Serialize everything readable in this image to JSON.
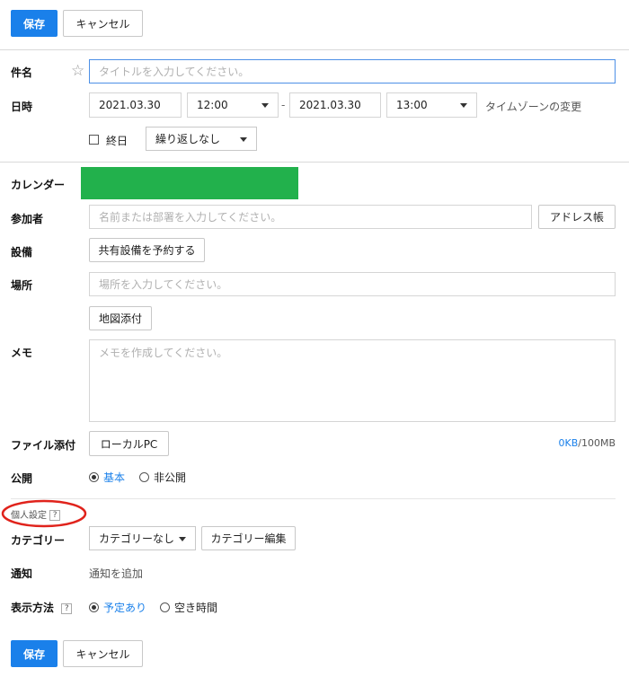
{
  "toolbar": {
    "save_label": "保存",
    "cancel_label": "キャンセル"
  },
  "subject": {
    "label": "件名",
    "placeholder": "タイトルを入力してください。"
  },
  "datetime": {
    "label": "日時",
    "start_date": "2021.03.30",
    "start_time": "12:00",
    "separator": "-",
    "end_date": "2021.03.30",
    "end_time": "13:00",
    "timezone_link": "タイムゾーンの変更",
    "all_day_label": "終日",
    "repeat_value": "繰り返しなし"
  },
  "calendar": {
    "label": "カレンダー",
    "color": "#22b14c"
  },
  "attendees": {
    "label": "参加者",
    "placeholder": "名前または部署を入力してください。",
    "address_book_label": "アドレス帳"
  },
  "equipment": {
    "label": "設備",
    "button_label": "共有設備を予約する"
  },
  "location": {
    "label": "場所",
    "placeholder": "場所を入力してください。",
    "map_button_label": "地図添付"
  },
  "memo": {
    "label": "メモ",
    "placeholder": "メモを作成してください。"
  },
  "attachment": {
    "label": "ファイル添付",
    "button_label": "ローカルPC",
    "used": "0KB",
    "limit": "/100MB"
  },
  "visibility": {
    "label": "公開",
    "options": [
      "基本",
      "非公開"
    ],
    "selected": "基本"
  },
  "personal": {
    "section_label": "個人設定",
    "help_icon": "?",
    "category": {
      "label": "カテゴリー",
      "value": "カテゴリーなし",
      "edit_label": "カテゴリー編集"
    },
    "notification": {
      "label": "通知",
      "add_label": "通知を追加"
    },
    "display": {
      "label": "表示方法",
      "options": [
        "予定あり",
        "空き時間"
      ],
      "selected": "予定あり"
    }
  },
  "colors": {
    "accent": "#1a80ea",
    "annotation": "#e0231c",
    "calendar": "#22b14c"
  }
}
